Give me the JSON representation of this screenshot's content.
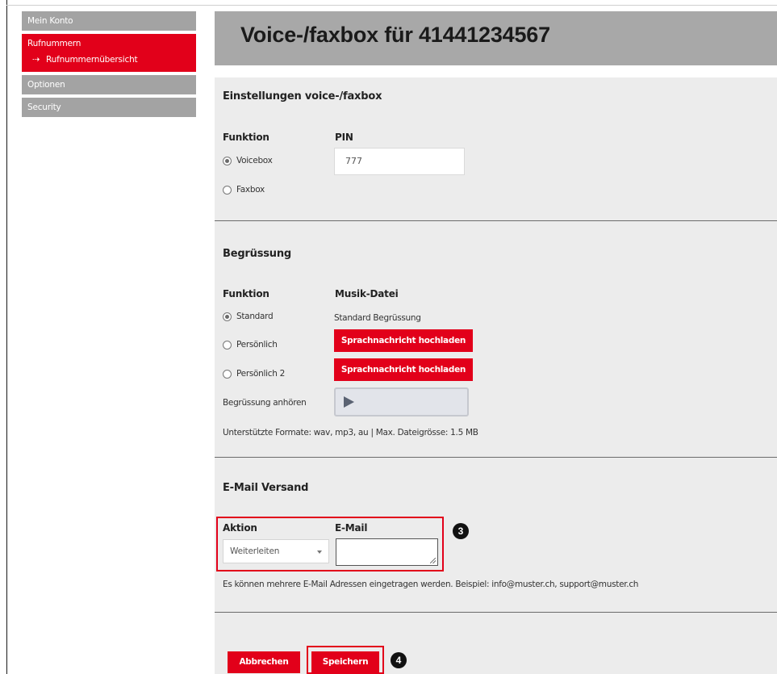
{
  "sidebar": {
    "items": [
      {
        "label": "Mein Konto"
      },
      {
        "label": "Rufnummern",
        "sub": "Rufnummernübersicht",
        "active": true
      },
      {
        "label": "Optionen"
      },
      {
        "label": "Security"
      }
    ]
  },
  "page": {
    "title": "Voice-/faxbox für 41441234567"
  },
  "settings": {
    "title": "Einstellungen voice-/faxbox",
    "funktion_label": "Funktion",
    "pin_label": "PIN",
    "pin_value": "777",
    "options": [
      {
        "label": "Voicebox",
        "checked": true
      },
      {
        "label": "Faxbox",
        "checked": false
      }
    ]
  },
  "greeting": {
    "title": "Begrüssung",
    "funktion_label": "Funktion",
    "musik_label": "Musik-Datei",
    "standard_text": "Standard Begrüssung",
    "options": [
      {
        "label": "Standard",
        "checked": true
      },
      {
        "label": "Persönlich",
        "checked": false
      },
      {
        "label": "Persönlich 2",
        "checked": false
      }
    ],
    "upload_label": "Sprachnachricht hochladen",
    "listen_label": "Begrüssung anhören",
    "formats_note": "Unterstützte Formate: wav, mp3, au | Max. Dateigrösse: 1.5 MB"
  },
  "email": {
    "title": "E-Mail Versand",
    "aktion_label": "Aktion",
    "email_label": "E-Mail",
    "aktion_value": "Weiterleiten",
    "email_value": "",
    "note": "Es können mehrere E-Mail Adressen eingetragen werden. Beispiel: info@muster.ch, support@muster.ch"
  },
  "actions": {
    "cancel_label": "Abbrechen",
    "save_label": "Speichern"
  },
  "annotations": {
    "badge_3": "3",
    "badge_4": "4"
  },
  "colors": {
    "accent": "#e2001a",
    "sidebar_gray": "#a3a3a3",
    "content_bg": "#ececec"
  }
}
